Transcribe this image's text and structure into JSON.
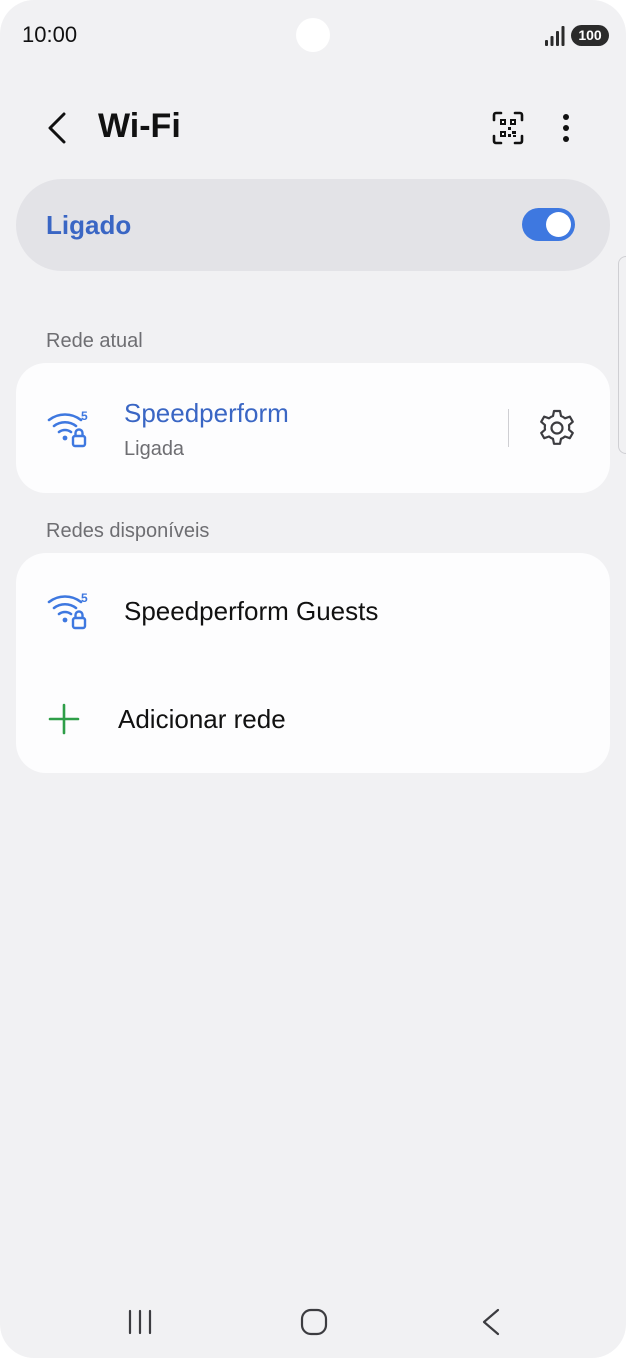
{
  "status_bar": {
    "time": "10:00",
    "battery": "100",
    "icons": [
      "signal-icon",
      "battery-icon"
    ]
  },
  "header": {
    "title": "Wi-Fi",
    "icons": [
      "back-arrow-icon",
      "qr-code-scan-icon",
      "more-vertical-icon"
    ]
  },
  "master_toggle": {
    "label": "Ligado",
    "state": "on"
  },
  "current_network": {
    "section_label": "Rede atual",
    "name": "Speedperform",
    "status": "Ligada",
    "band": "5",
    "icons": [
      "wifi-secured-5ghz-icon",
      "gear-icon"
    ]
  },
  "available_networks": {
    "section_label": "Redes disponíveis",
    "items": [
      {
        "name": "Speedperform Guests",
        "band": "5"
      }
    ],
    "add_network_label": "Adicionar rede"
  },
  "colors": {
    "accent": "#3e78e0",
    "label_blue": "#3a66c4",
    "add_green": "#2e9e48",
    "background": "#f1f1f3",
    "card": "#fdfdfe"
  },
  "nav_bar": {
    "icons": [
      "recents-icon",
      "home-icon",
      "back-icon"
    ]
  }
}
